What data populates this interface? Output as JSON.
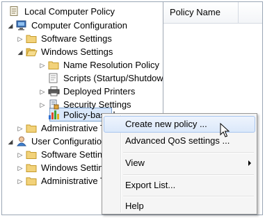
{
  "tree": {
    "items": [
      {
        "label": "Local Computer Policy",
        "expander": "",
        "icon": "policy-document-icon"
      },
      {
        "label": "Computer Configuration",
        "expander": "◢",
        "icon": "computer-icon"
      },
      {
        "label": "Software Settings",
        "expander": "▷",
        "icon": "folder-icon"
      },
      {
        "label": "Windows Settings",
        "expander": "◢",
        "icon": "folder-icon"
      },
      {
        "label": "Name Resolution Policy",
        "expander": "▷",
        "icon": "folder-icon"
      },
      {
        "label": "Scripts (Startup/Shutdown)",
        "expander": "",
        "icon": "scripts-icon"
      },
      {
        "label": "Deployed Printers",
        "expander": "▷",
        "icon": "printer-icon"
      },
      {
        "label": "Security Settings",
        "expander": "▷",
        "icon": "security-icon"
      },
      {
        "label": "Policy-based QoS",
        "expander": "",
        "icon": "qos-chart-icon"
      },
      {
        "label": "Administrative Templates",
        "expander": "▷",
        "icon": "folder-icon"
      },
      {
        "label": "User Configuration",
        "expander": "◢",
        "icon": "user-icon"
      },
      {
        "label": "Software Settings",
        "expander": "▷",
        "icon": "folder-icon"
      },
      {
        "label": "Windows Settings",
        "expander": "▷",
        "icon": "folder-icon"
      },
      {
        "label": "Administrative Templates",
        "expander": "▷",
        "icon": "folder-icon"
      }
    ]
  },
  "list": {
    "columns": [
      "Policy Name"
    ]
  },
  "context_menu": {
    "items": [
      {
        "label": "Create new policy ...",
        "highlighted": true
      },
      {
        "label": "Advanced QoS settings ..."
      },
      {
        "label": "View",
        "submenu": true
      },
      {
        "label": "Export List..."
      },
      {
        "label": "Help"
      }
    ]
  },
  "colors": {
    "selection": "#d9e8fb",
    "menu_background": "#f5f5f5",
    "folder": "#e9c46a"
  }
}
